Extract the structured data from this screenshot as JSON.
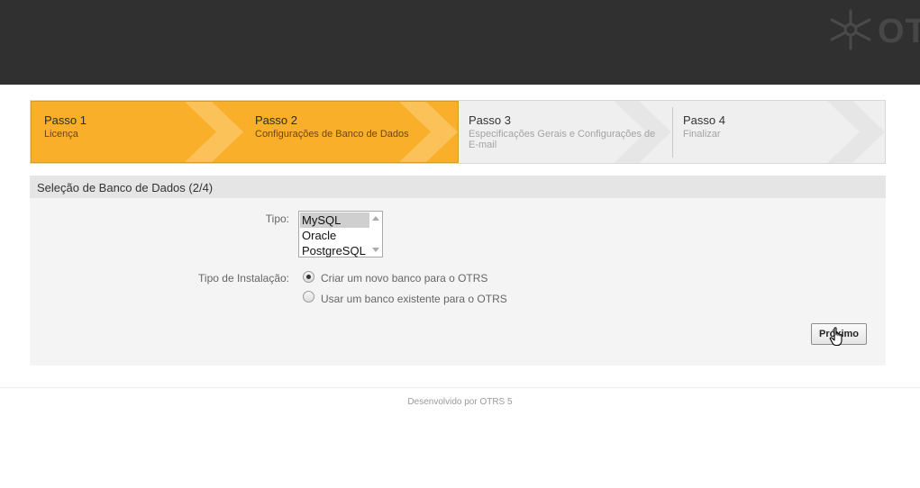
{
  "header": {
    "logo_text": "OTRS"
  },
  "steps": [
    {
      "title": "Passo 1",
      "subtitle": "Licença",
      "state": "done"
    },
    {
      "title": "Passo 2",
      "subtitle": "Configurações de Banco de Dados",
      "state": "current"
    },
    {
      "title": "Passo 3",
      "subtitle_line1": "Especificações Gerais e Configurações de",
      "subtitle_line2": "E-mail",
      "state": "pending"
    },
    {
      "title": "Passo 4",
      "subtitle": "Finalizar",
      "state": "pending"
    }
  ],
  "panel": {
    "title": "Seleção de Banco de Dados (2/4)",
    "type_label": "Tipo:",
    "type_options": [
      "MySQL",
      "Oracle",
      "PostgreSQL"
    ],
    "type_selected": "MySQL",
    "install_label": "Tipo de Instalação:",
    "install_options": [
      {
        "label": "Criar um novo banco para o OTRS",
        "checked": true
      },
      {
        "label": "Usar um banco existente para o OTRS",
        "checked": false
      }
    ],
    "next_button": "Próximo"
  },
  "footer": {
    "text": "Desenvolvido por OTRS 5"
  },
  "colors": {
    "header_bg": "#303030",
    "active_step": "#f9af2a",
    "inactive_step": "#efefef"
  },
  "icons": {
    "logo": "otrs-asterisk-icon",
    "cursor": "hand-pointer-icon"
  }
}
